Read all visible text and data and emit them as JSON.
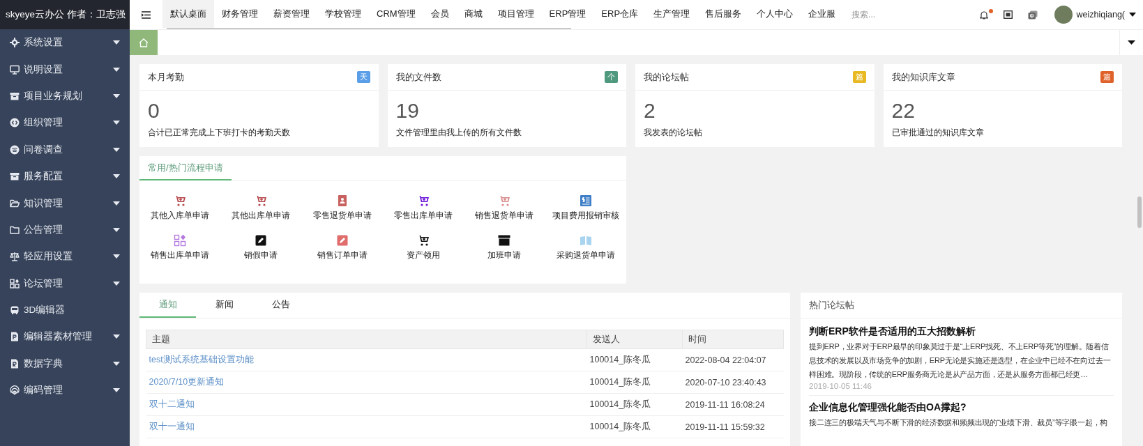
{
  "brand": "skyeye云办公 作者：卫志强",
  "sidebar": {
    "items": [
      {
        "label": "系统设置",
        "expandable": true
      },
      {
        "label": "说明设置",
        "expandable": true
      },
      {
        "label": "项目业务规划",
        "expandable": true
      },
      {
        "label": "组织管理",
        "expandable": true
      },
      {
        "label": "问卷调查",
        "expandable": true
      },
      {
        "label": "服务配置",
        "expandable": true
      },
      {
        "label": "知识管理",
        "expandable": true
      },
      {
        "label": "公告管理",
        "expandable": true
      },
      {
        "label": "轻应用设置",
        "expandable": true
      },
      {
        "label": "论坛管理",
        "expandable": true
      },
      {
        "label": "3D编辑器",
        "expandable": false
      },
      {
        "label": "编辑器素材管理",
        "expandable": true
      },
      {
        "label": "数据字典",
        "expandable": true
      },
      {
        "label": "编码管理",
        "expandable": true
      }
    ]
  },
  "topbar": {
    "nav": [
      {
        "label": "默认桌面",
        "selected": true
      },
      {
        "label": "财务管理",
        "selected": false
      },
      {
        "label": "薪资管理",
        "selected": false
      },
      {
        "label": "学校管理",
        "selected": false
      },
      {
        "label": "CRM管理",
        "selected": false
      },
      {
        "label": "会员",
        "selected": false
      },
      {
        "label": "商城",
        "selected": false
      },
      {
        "label": "项目管理",
        "selected": false
      },
      {
        "label": "ERP管理",
        "selected": false
      },
      {
        "label": "ERP仓库",
        "selected": false
      },
      {
        "label": "生产管理",
        "selected": false
      },
      {
        "label": "售后服务",
        "selected": false
      },
      {
        "label": "个人中心",
        "selected": false
      },
      {
        "label": "企业服",
        "selected": false
      }
    ],
    "search": {
      "placeholder": "搜索..."
    },
    "notification_dot": true,
    "username": "weizhiqiang("
  },
  "cards": [
    {
      "title": "本月考勤",
      "badge": "天",
      "color": "#5a9ee8",
      "value": "0",
      "description": "合计已正常完成上下班打卡的考勤天数"
    },
    {
      "title": "我的文件数",
      "badge": "个",
      "color": "#4f9a7e",
      "value": "19",
      "description": "文件管理里由我上传的所有文件数"
    },
    {
      "title": "我的论坛帖",
      "badge": "篇",
      "color": "#e8b923",
      "value": "2",
      "description": "我发表的论坛帖"
    },
    {
      "title": "我的知识库文章",
      "badge": "篇",
      "color": "#e0622b",
      "value": "22",
      "description": "已审批通过的知识库文章"
    }
  ],
  "process": {
    "title": "常用/热门流程申请",
    "items": [
      {
        "label": "其他入库单申请",
        "color": "#b5474b"
      },
      {
        "label": "其他出库单申请",
        "color": "#b5474b"
      },
      {
        "label": "零售退货单申请",
        "color": "#c8605f"
      },
      {
        "label": "零售出库单申请",
        "color": "#6a12d8"
      },
      {
        "label": "销售退货单申请",
        "color": "#d98a8a"
      },
      {
        "label": "项目费用报销审核",
        "color": "#3f7fc7"
      },
      {
        "label": "销售出库单申请",
        "color": "#b57be0"
      },
      {
        "label": "销假申请",
        "color": "#111111"
      },
      {
        "label": "销售订单申请",
        "color": "#e06c6c"
      },
      {
        "label": "资产领用",
        "color": "#111111"
      },
      {
        "label": "加班申请",
        "color": "#111111"
      },
      {
        "label": "采购退货单申请",
        "color": "#a8d4f0"
      }
    ]
  },
  "notices": {
    "tabs": [
      {
        "label": "通知",
        "selected": true
      },
      {
        "label": "新闻",
        "selected": false
      },
      {
        "label": "公告",
        "selected": false
      }
    ],
    "columns": [
      "主题",
      "发送人",
      "时间"
    ],
    "rows": [
      {
        "subject": "test测试系统基础设置功能",
        "sender": "100014_陈冬瓜",
        "time": "2022-08-04 22:04:07"
      },
      {
        "subject": "2020/7/10更新通知",
        "sender": "100014_陈冬瓜",
        "time": "2020-07-10 23:40:43"
      },
      {
        "subject": "双十二通知",
        "sender": "100014_陈冬瓜",
        "time": "2019-11-11 16:08:24"
      },
      {
        "subject": "双十一通知",
        "sender": "100014_陈冬瓜",
        "time": "2019-11-11 15:59:32"
      }
    ]
  },
  "forum": {
    "title": "热门论坛帖",
    "posts": [
      {
        "title": "判断ERP软件是否适用的五大招数解析",
        "excerpt": "提到ERP，业界对于ERP最早的印象莫过于是“上ERP找死、不上ERP等死”的理解。随着信息技术的发展以及市场竞争的加剧，ERP无论是实施还是选型，在企业中已经不在向过去一样困难。现阶段，传统的ERP服务商无论是从产品方面，还是从服务方面都已经更…",
        "date": "2019-10-05 11:46"
      },
      {
        "title": "企业信息化管理强化能否由OA撑起?",
        "excerpt": "接二连三的极端天气与不断下滑的经济数据和频频出现的“业绩下滑、裁员”等字眼一起，构"
      }
    ]
  }
}
